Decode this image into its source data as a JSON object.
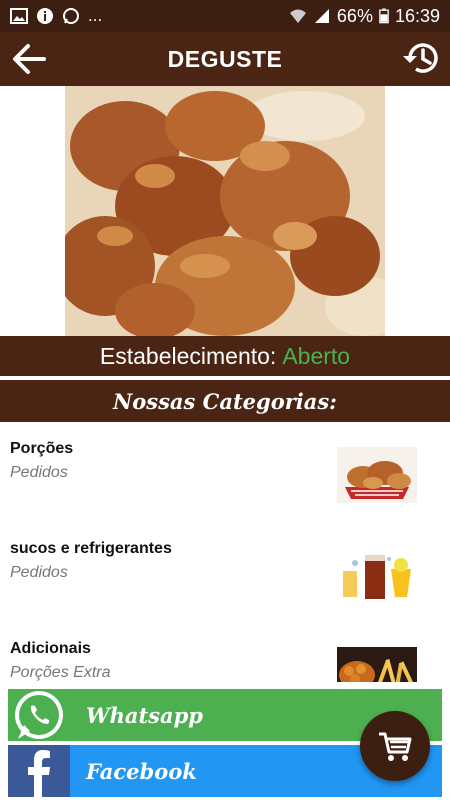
{
  "status_bar": {
    "battery": "66%",
    "time": "16:39",
    "dots": "..."
  },
  "app_bar": {
    "title": "DEGUSTE",
    "back_icon": "arrow-left-icon",
    "history_icon": "history-icon"
  },
  "establishment": {
    "label": "Estabelecimento:",
    "status": "Aberto",
    "status_color": "#4caf50"
  },
  "categories": {
    "header": "Nossas Categorias:",
    "items": [
      {
        "name": "Porções",
        "subtitle": "Pedidos"
      },
      {
        "name": "sucos e refrigerantes",
        "subtitle": "Pedidos"
      },
      {
        "name": "Adicionais",
        "subtitle": "Porções  Extra"
      }
    ]
  },
  "social": {
    "whatsapp_label": "Whatsapp",
    "facebook_label": "Facebook",
    "whatsapp_color": "#4caf50",
    "facebook_color": "#2196f3"
  },
  "colors": {
    "brand_dark": "#4a2514",
    "status_bar": "#3d1f11"
  }
}
